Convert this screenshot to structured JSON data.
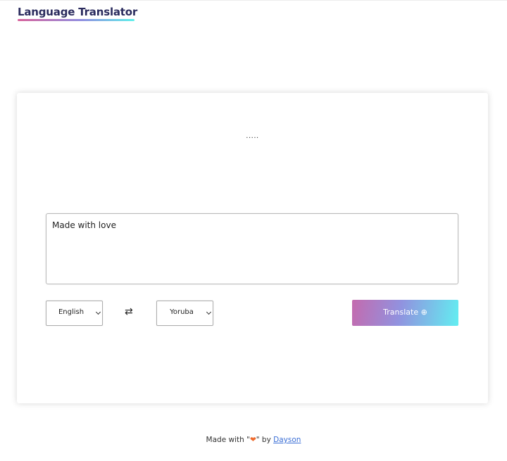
{
  "header": {
    "title": "Language Translator"
  },
  "translator": {
    "output_text": ".....",
    "input_text": "Made with love",
    "source_language": "English",
    "target_language": "Yoruba",
    "swap_symbol": "⇄",
    "translate_label": "Translate",
    "translate_icon": "⊕"
  },
  "footer": {
    "prefix": "Made with \"",
    "heart": "❤",
    "suffix": "\" by ",
    "author": "Dayson"
  },
  "colors": {
    "title": "#2b2c5e",
    "button_gradient": [
      "#c46aae",
      "#9192df",
      "#62eef1"
    ],
    "heart": "#ee6a2c",
    "link": "#3b6fd6"
  }
}
